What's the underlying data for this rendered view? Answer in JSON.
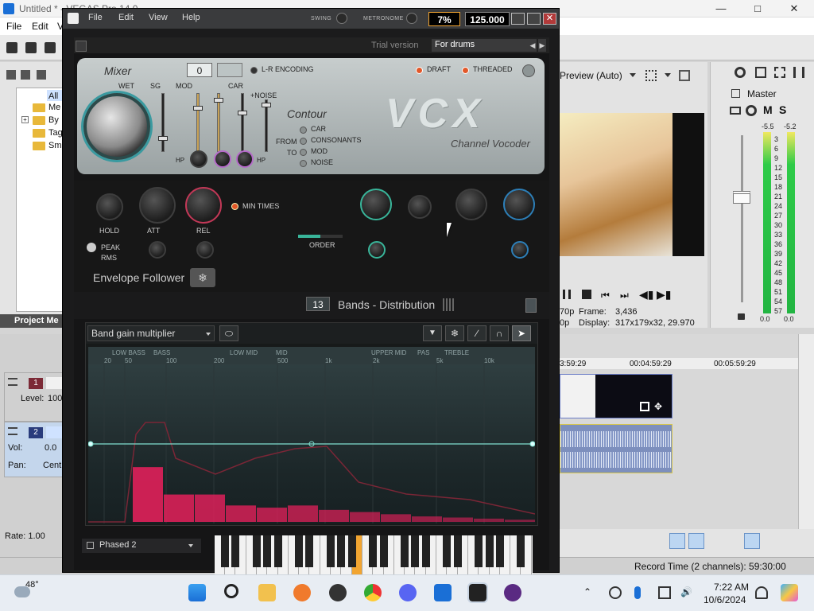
{
  "vegas": {
    "title": "Untitled * - VEGAS Pro 14.0",
    "menu": [
      "File",
      "Edit",
      "V"
    ],
    "explorer": {
      "tree": [
        "All",
        "Me",
        "By",
        "Tag",
        "Sm"
      ],
      "project_media_tab": "Project Me"
    },
    "tracks": [
      {
        "number": "1",
        "level_label": "Level:",
        "level_value": "100"
      },
      {
        "number": "2",
        "vol_label": "Vol:",
        "vol_value": "0.0",
        "pan_label": "Pan:",
        "pan_value": "Cent"
      }
    ],
    "rate": "Rate: 1.00",
    "preview": {
      "mode": "Preview (Auto)",
      "frame_label": "Frame:",
      "frame_value": "3,436",
      "display_label": "Display:",
      "display_value": "317x179x32, 29.970",
      "frame_prefix": "70p",
      "display_prefix": "0p"
    },
    "master": {
      "title": "Master",
      "buttons": [
        "M",
        "S"
      ],
      "peak_left": "-5.5",
      "peak_right": "-5.2",
      "scale": [
        "3",
        "6",
        "9",
        "12",
        "15",
        "18",
        "21",
        "24",
        "27",
        "30",
        "33",
        "36",
        "39",
        "42",
        "45",
        "48",
        "51",
        "54",
        "57"
      ],
      "bottom_left": "0.0",
      "bottom_right": "0.0"
    },
    "timeline": {
      "ruler": [
        "3:59:29",
        "00:04:59:29",
        "00:05:59:29"
      ]
    },
    "status": "Record Time (2 channels): 59:30:00"
  },
  "plugin": {
    "menu": [
      "File",
      "Edit",
      "View",
      "Help"
    ],
    "swing_label": "SWING",
    "metronome_label": "METRONOME",
    "percent": "7%",
    "tempo": "125.000",
    "trial": "Trial version",
    "preset": "For drums",
    "mixer": {
      "title": "Mixer",
      "wet": "WET",
      "sg": "SG",
      "mod": "MOD",
      "car": "CAR",
      "noise_plus": "+NOISE",
      "value": "0",
      "lr_encoding": "L-R ENCODING",
      "draft": "DRAFT",
      "threaded": "THREADED",
      "hp1": "HP",
      "hp2": "HP",
      "contour_title": "Contour",
      "from": "FROM",
      "to": "TO",
      "contour_options": [
        "CAR",
        "CONSONANTS",
        "MOD",
        "NOISE"
      ],
      "logo": "VCX",
      "subtitle": "Channel Vocoder"
    },
    "envelope": {
      "hold": "HOLD",
      "att": "ATT",
      "rel": "REL",
      "min_times": "MIN TIMES",
      "peak": "PEAK",
      "rms": "RMS",
      "order": "ORDER",
      "title": "Envelope Follower"
    },
    "bands": {
      "count": "13",
      "title": "Bands - Distribution"
    },
    "editor": {
      "dropdown": "Band gain multiplier",
      "freq_labels_top": [
        "LOW BASS",
        "BASS",
        "LOW MID",
        "MID",
        "UPPER MID",
        "PAS",
        "TREBLE"
      ],
      "freq_ticks": [
        "20",
        "50",
        "100",
        "200",
        "500",
        "1k",
        "2k",
        "5k",
        "10k"
      ],
      "band_levels": [
        0.5,
        0.25,
        0.25,
        0.15,
        0.13,
        0.15,
        0.11,
        0.09,
        0.07,
        0.05,
        0.04,
        0.03,
        0.02
      ],
      "line_level": 0.5
    },
    "bottom_preset": "Phased 2"
  },
  "taskbar": {
    "temp": "48°",
    "time": "7:22 AM",
    "date": "10/6/2024"
  }
}
